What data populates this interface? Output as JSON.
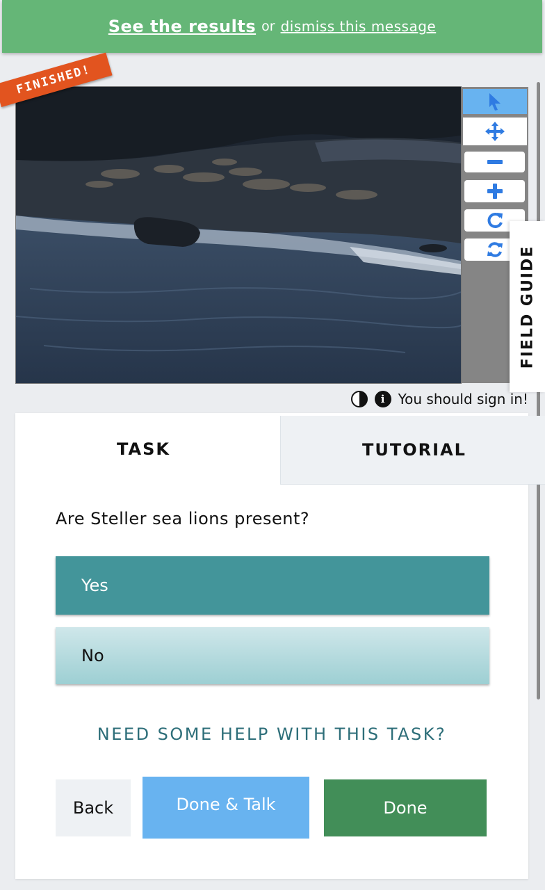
{
  "banner": {
    "results_link": "See the results",
    "or_text": "or",
    "dismiss_link": "dismiss this message"
  },
  "subject": {
    "status_ribbon": "FINISHED!"
  },
  "toolbar": {
    "tools": [
      {
        "name": "pointer",
        "icon": "pointer-icon"
      },
      {
        "name": "pan",
        "icon": "move-arrows-icon"
      },
      {
        "name": "zoom-out",
        "icon": "minus-icon"
      },
      {
        "name": "zoom-in",
        "icon": "plus-icon"
      },
      {
        "name": "rotate",
        "icon": "rotate-icon"
      },
      {
        "name": "reset",
        "icon": "refresh-icon"
      }
    ]
  },
  "field_guide": {
    "label": "FIELD GUIDE"
  },
  "meta": {
    "sign_in_text": "You should sign in!",
    "info_glyph": "i"
  },
  "tabs": {
    "task": "TASK",
    "tutorial": "TUTORIAL"
  },
  "task": {
    "question": "Are Steller sea lions present?",
    "answers": [
      "Yes",
      "No"
    ],
    "selected": "Yes",
    "help_link": "NEED SOME HELP WITH THIS TASK?"
  },
  "actions": {
    "back": "Back",
    "done_talk": "Done & Talk",
    "done": "Done"
  },
  "colors": {
    "banner": "#65b677",
    "ribbon": "#e2541f",
    "toolbar_active": "#68b3f0",
    "yes_selected": "#43959a",
    "done": "#428e58",
    "help_text": "#2d6e79"
  }
}
